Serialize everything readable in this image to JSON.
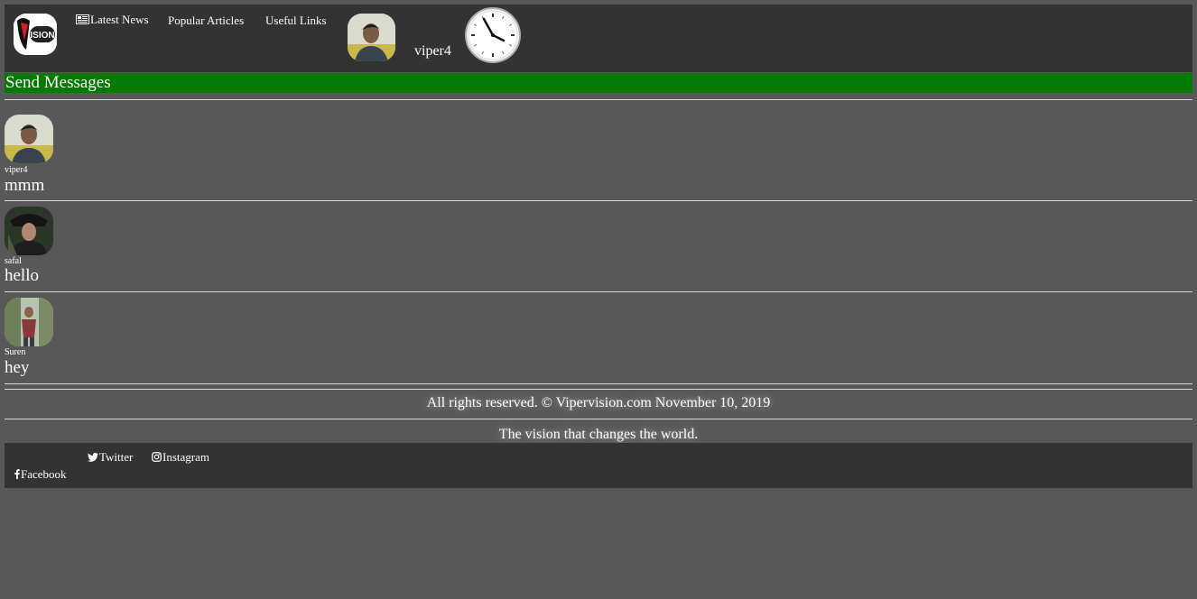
{
  "header": {
    "logo_text": "VISION",
    "nav": [
      {
        "label": "Latest News",
        "icon": "newspaper-icon"
      },
      {
        "label": "Popular Articles"
      },
      {
        "label": "Useful Links"
      }
    ],
    "username": "viper4"
  },
  "section": {
    "title": "Send Messages"
  },
  "messages": [
    {
      "sender": "viper4",
      "text": "mmm"
    },
    {
      "sender": "safal",
      "text": "hello"
    },
    {
      "sender": "Suren",
      "text": "hey"
    }
  ],
  "footer": {
    "rights": "All rights reserved. © Vipervision.com November 10, 2019",
    "tagline": "The vision that changes the world.",
    "social": [
      {
        "label": "Twitter",
        "icon": "twitter-icon"
      },
      {
        "label": "Instagram",
        "icon": "instagram-icon"
      },
      {
        "label": "Facebook",
        "icon": "facebook-icon"
      }
    ]
  },
  "colors": {
    "page_bg": "#585858",
    "bar_bg": "#333333",
    "section_bg": "#027b00",
    "text": "#ffffff"
  }
}
